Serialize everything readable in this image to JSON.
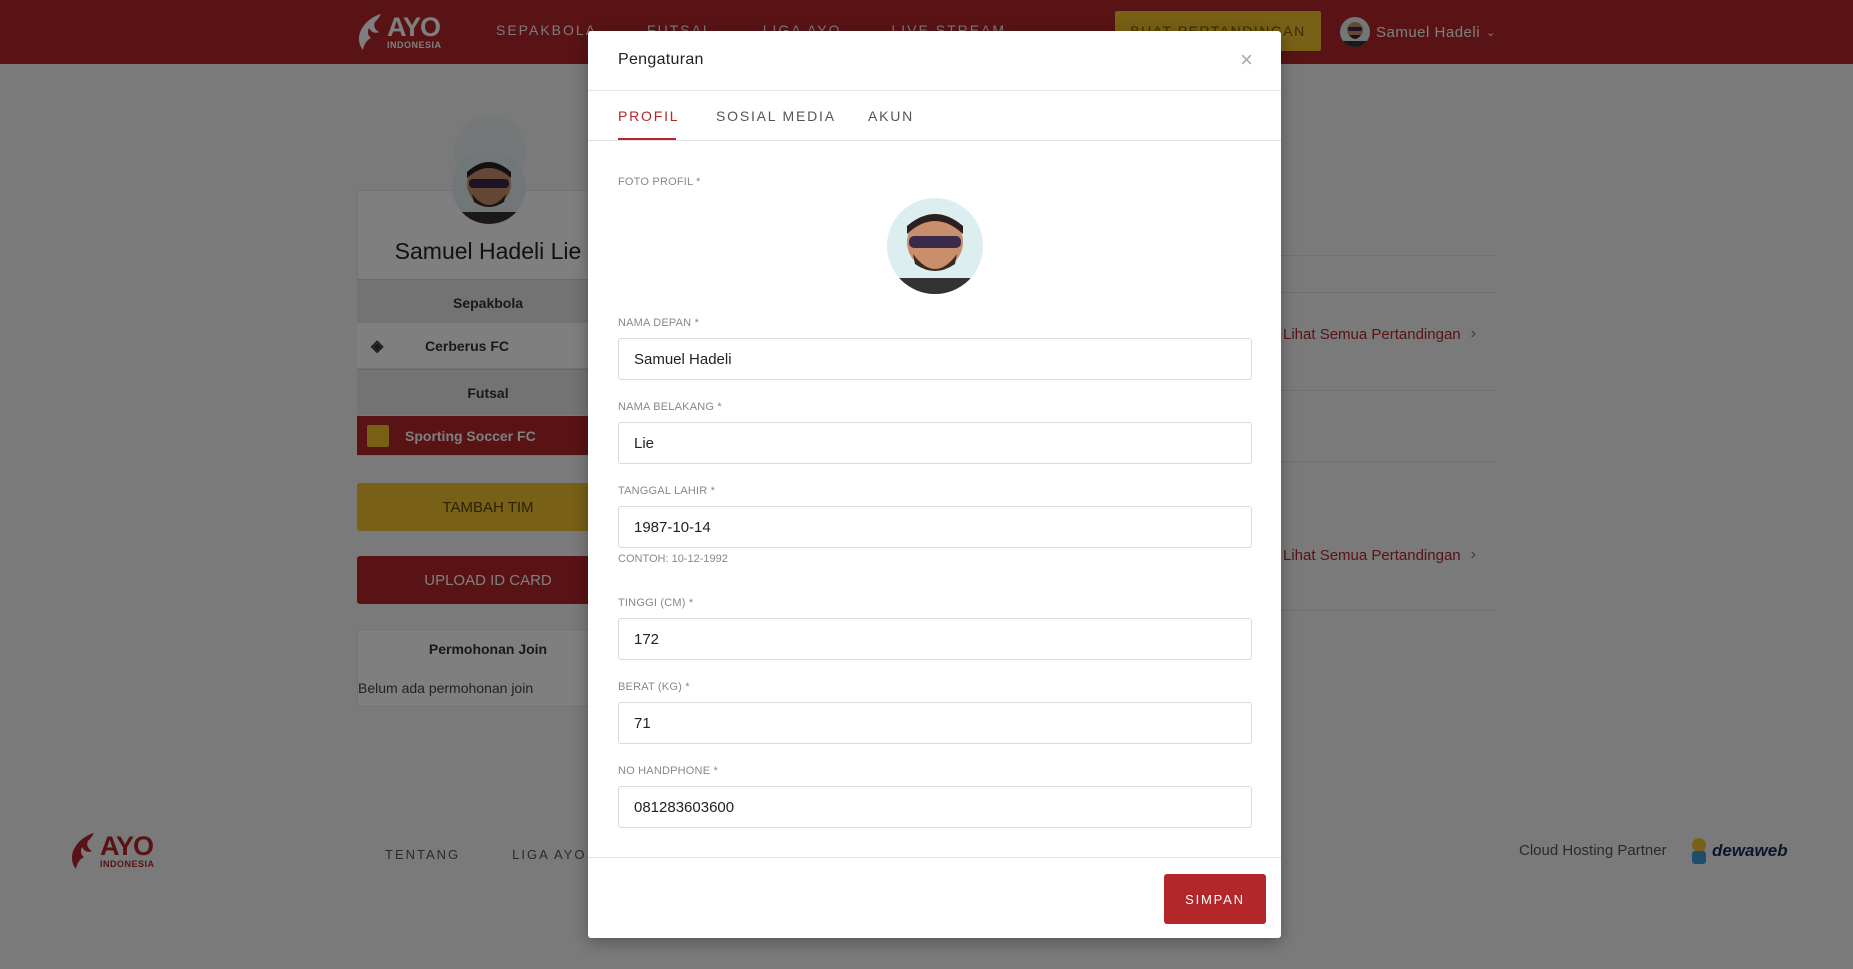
{
  "header": {
    "logo_text": "AYO",
    "logo_sub": "INDONESIA",
    "nav": [
      "SEPAKBOLA",
      "FUTSAL",
      "LIGA AYO",
      "LIVE STREAM"
    ],
    "cta_label": "BUAT PERTANDINGAN",
    "user_name": "Samuel Hadeli"
  },
  "profile": {
    "name": "Samuel Hadeli Lie",
    "sections": [
      {
        "title": "Sepakbola",
        "team": "Cerberus FC"
      },
      {
        "title": "Futsal",
        "team": "Sporting Soccer FC"
      }
    ],
    "add_team_label": "TAMBAH TIM",
    "upload_label": "UPLOAD ID CARD",
    "join_title": "Permohonan Join",
    "join_empty": "Belum ada permohonan join"
  },
  "matches": {
    "see_all_label": "Lihat Semua Pertandingan"
  },
  "footer": {
    "links": [
      "TENTANG",
      "LIGA AYO"
    ],
    "partner_label": "Cloud Hosting Partner",
    "partner_name": "dewaweb"
  },
  "modal": {
    "title": "Pengaturan",
    "tabs": [
      "PROFIL",
      "SOSIAL MEDIA",
      "AKUN"
    ],
    "active_tab": "PROFIL",
    "photo_label": "FOTO PROFIL *",
    "fields": {
      "first_name": {
        "label": "NAMA DEPAN *",
        "value": "Samuel Hadeli"
      },
      "last_name": {
        "label": "NAMA BELAKANG *",
        "value": "Lie"
      },
      "birth_date": {
        "label": "TANGGAL LAHIR *",
        "value": "1987-10-14",
        "hint": "CONTOH: 10-12-1992"
      },
      "height": {
        "label": "TINGGI (CM) *",
        "value": "172"
      },
      "weight": {
        "label": "BERAT (KG) *",
        "value": "71"
      },
      "phone": {
        "label": "NO HANDPHONE *",
        "value": "081283603600"
      }
    },
    "save_label": "SIMPAN"
  },
  "colors": {
    "brand_red": "#b3262a",
    "brand_yellow": "#f1c12c"
  }
}
